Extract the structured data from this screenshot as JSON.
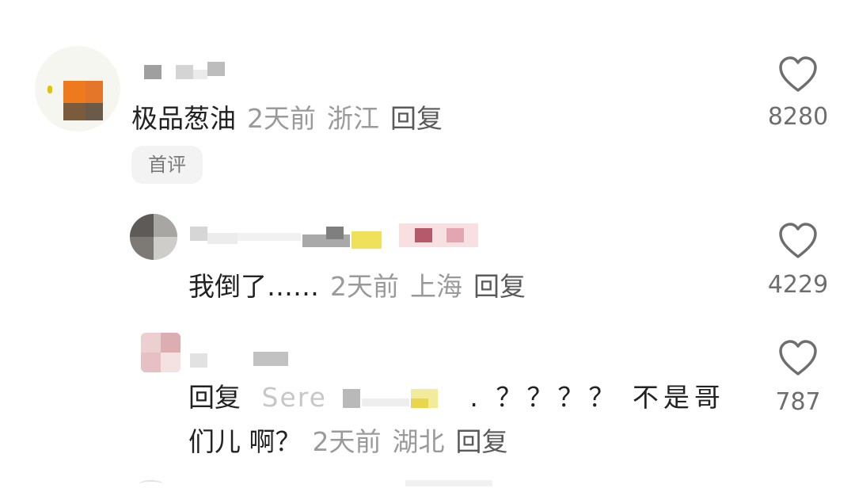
{
  "comments": [
    {
      "text": "极品葱油",
      "time": "2天前",
      "location": "浙江",
      "reply_label": "回复",
      "badge": "首评",
      "likes": "8280"
    },
    {
      "text": "我倒了……",
      "time": "2天前",
      "location": "上海",
      "reply_label": "回复",
      "likes": "4229"
    },
    {
      "reply_prefix": "回复",
      "mention": "Sere",
      "text_line1": ". ？？？？ 不是哥",
      "text_line2": "们儿 啊？",
      "time": "2天前",
      "location": "湖北",
      "reply_label": "回复",
      "likes": "787"
    }
  ],
  "icons": {
    "like": "heart-outline-icon"
  },
  "colors": {
    "text": "#222222",
    "meta": "#9a9a9a",
    "badge_bg": "#f3f3f3",
    "icon": "#6e6e6e"
  }
}
